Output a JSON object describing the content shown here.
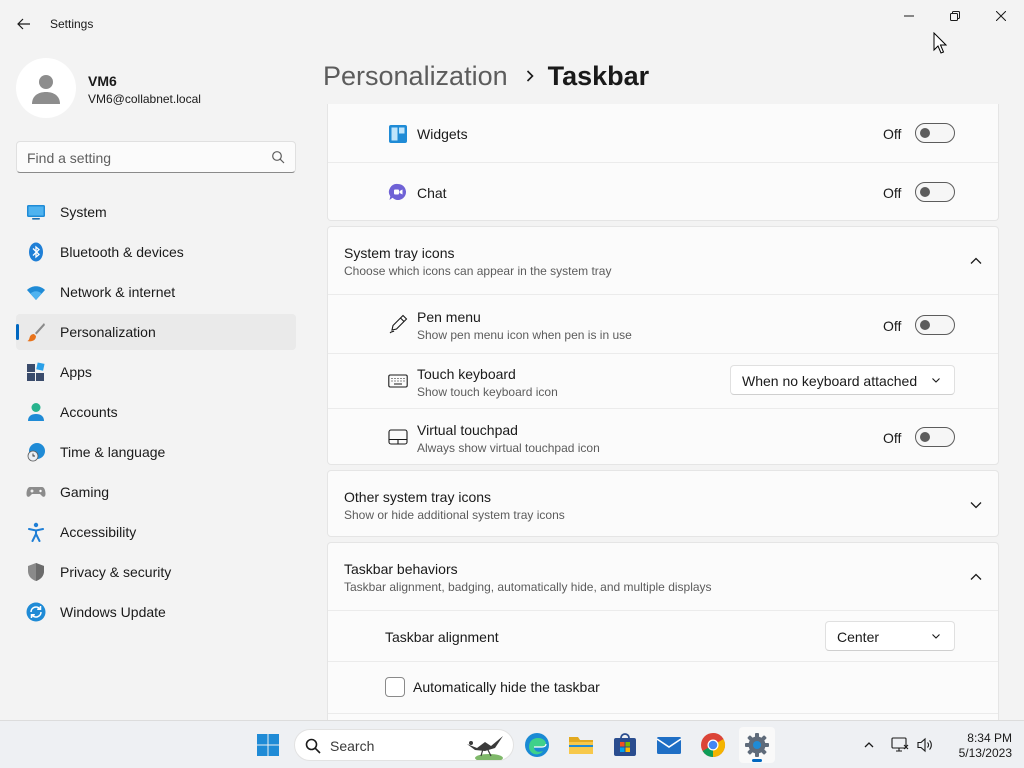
{
  "window": {
    "title": "Settings"
  },
  "profile": {
    "name": "VM6",
    "email": "VM6@collabnet.local"
  },
  "search": {
    "placeholder": "Find a setting"
  },
  "sidebar": {
    "items": [
      {
        "label": "System",
        "icon": "monitor-icon"
      },
      {
        "label": "Bluetooth & devices",
        "icon": "bluetooth-icon"
      },
      {
        "label": "Network & internet",
        "icon": "wifi-icon"
      },
      {
        "label": "Personalization",
        "icon": "brush-icon",
        "active": true
      },
      {
        "label": "Apps",
        "icon": "apps-icon"
      },
      {
        "label": "Accounts",
        "icon": "person-icon"
      },
      {
        "label": "Time & language",
        "icon": "globe-clock-icon"
      },
      {
        "label": "Gaming",
        "icon": "gamepad-icon"
      },
      {
        "label": "Accessibility",
        "icon": "accessibility-icon"
      },
      {
        "label": "Privacy & security",
        "icon": "shield-icon"
      },
      {
        "label": "Windows Update",
        "icon": "update-icon"
      }
    ]
  },
  "breadcrumb": {
    "parent": "Personalization",
    "current": "Taskbar"
  },
  "taskbar_items": {
    "widgets": {
      "label": "Widgets",
      "state": "Off"
    },
    "chat": {
      "label": "Chat",
      "state": "Off"
    }
  },
  "system_tray": {
    "title": "System tray icons",
    "subtitle": "Choose which icons can appear in the system tray",
    "pen_menu": {
      "label": "Pen menu",
      "sub": "Show pen menu icon when pen is in use",
      "state": "Off"
    },
    "touch_keyboard": {
      "label": "Touch keyboard",
      "sub": "Show touch keyboard icon",
      "value": "When no keyboard attached"
    },
    "virtual_touchpad": {
      "label": "Virtual touchpad",
      "sub": "Always show virtual touchpad icon",
      "state": "Off"
    }
  },
  "other_tray": {
    "title": "Other system tray icons",
    "subtitle": "Show or hide additional system tray icons"
  },
  "behaviors": {
    "title": "Taskbar behaviors",
    "subtitle": "Taskbar alignment, badging, automatically hide, and multiple displays",
    "alignment_label": "Taskbar alignment",
    "alignment_value": "Center",
    "autohide_label": "Automatically hide the taskbar"
  },
  "taskbar": {
    "search_label": "Search",
    "time": "8:34 PM",
    "date": "5/13/2023"
  },
  "colors": {
    "accent": "#0067c0",
    "card": "#fbfbfb",
    "background": "#f3f3f3"
  }
}
